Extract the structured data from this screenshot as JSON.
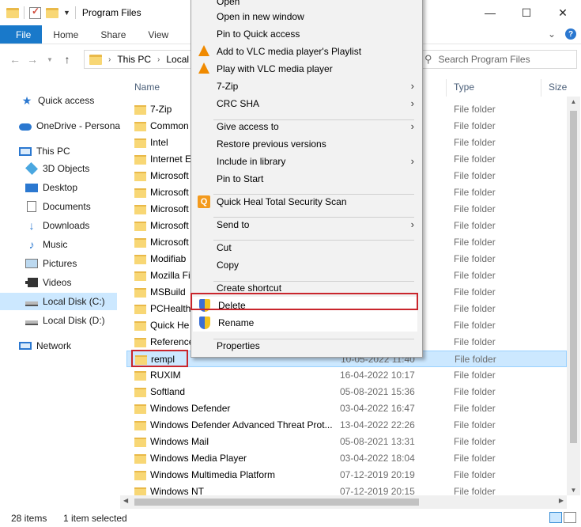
{
  "window": {
    "title": "Program Files",
    "minimize": "—",
    "maximize": "☐",
    "close": "✕"
  },
  "ribbon": {
    "tabs": [
      "File",
      "Home",
      "Share",
      "View"
    ],
    "expand": "⌄",
    "help": "?"
  },
  "address": {
    "path_parts": [
      "This PC",
      "Local"
    ],
    "search_placeholder": "Search Program Files"
  },
  "nav_pane": [
    {
      "label": "Quick access",
      "icon": "star-icon"
    },
    {
      "label": "OneDrive - Persona",
      "icon": "cloud-icon"
    },
    {
      "label": "This PC",
      "icon": "computer-icon"
    },
    {
      "label": "3D Objects",
      "icon": "cube-icon"
    },
    {
      "label": "Desktop",
      "icon": "desktop-icon"
    },
    {
      "label": "Documents",
      "icon": "document-icon"
    },
    {
      "label": "Downloads",
      "icon": "download-icon"
    },
    {
      "label": "Music",
      "icon": "music-icon"
    },
    {
      "label": "Pictures",
      "icon": "picture-icon"
    },
    {
      "label": "Videos",
      "icon": "video-icon"
    },
    {
      "label": "Local Disk (C:)",
      "icon": "disk-icon"
    },
    {
      "label": "Local Disk (D:)",
      "icon": "disk-icon"
    },
    {
      "label": "Network",
      "icon": "network-icon"
    }
  ],
  "columns": {
    "name": "Name",
    "type": "Type",
    "size": "Size"
  },
  "files": [
    {
      "name": "7-Zip",
      "date": "",
      "type": "File folder"
    },
    {
      "name": "Common",
      "date": "",
      "type": "File folder"
    },
    {
      "name": "Intel",
      "date": "",
      "type": "File folder"
    },
    {
      "name": "Internet E",
      "date": "",
      "type": "File folder"
    },
    {
      "name": "Microsoft",
      "date": "",
      "type": "File folder"
    },
    {
      "name": "Microsoft",
      "date": "",
      "type": "File folder"
    },
    {
      "name": "Microsoft",
      "date": "",
      "type": "File folder"
    },
    {
      "name": "Microsoft",
      "date": "",
      "type": "File folder"
    },
    {
      "name": "Microsoft",
      "date": "",
      "type": "File folder"
    },
    {
      "name": "Modifiab",
      "date": "",
      "type": "File folder"
    },
    {
      "name": "Mozilla Fi",
      "date": "",
      "type": "File folder"
    },
    {
      "name": "MSBuild",
      "date": "",
      "type": "File folder"
    },
    {
      "name": "PCHealth",
      "date": "",
      "type": "File folder"
    },
    {
      "name": "Quick He",
      "date": "",
      "type": "File folder"
    },
    {
      "name": "Reference",
      "date": "",
      "type": "File folder"
    },
    {
      "name": "rempl",
      "date": "10-05-2022 11:40",
      "type": "File folder"
    },
    {
      "name": "RUXIM",
      "date": "16-04-2022 10:17",
      "type": "File folder"
    },
    {
      "name": "Softland",
      "date": "05-08-2021 15:36",
      "type": "File folder"
    },
    {
      "name": "Windows Defender",
      "date": "03-04-2022 16:47",
      "type": "File folder"
    },
    {
      "name": "Windows Defender Advanced Threat Prot...",
      "date": "13-04-2022 22:26",
      "type": "File folder"
    },
    {
      "name": "Windows Mail",
      "date": "05-08-2021 13:31",
      "type": "File folder"
    },
    {
      "name": "Windows Media Player",
      "date": "03-04-2022 18:04",
      "type": "File folder"
    },
    {
      "name": "Windows Multimedia Platform",
      "date": "07-12-2019 20:19",
      "type": "File folder"
    },
    {
      "name": "Windows NT",
      "date": "07-12-2019 20:15",
      "type": "File folder"
    }
  ],
  "status": {
    "items": "28 items",
    "selected": "1 item selected"
  },
  "context_menu": [
    {
      "label": "Open",
      "icon": ""
    },
    {
      "label": "Open in new window",
      "icon": ""
    },
    {
      "label": "Pin to Quick access",
      "icon": ""
    },
    {
      "label": "Add to VLC media player's Playlist",
      "icon": "vlc-icon"
    },
    {
      "label": "Play with VLC media player",
      "icon": "vlc-icon"
    },
    {
      "label": "7-Zip",
      "icon": "",
      "submenu": true
    },
    {
      "label": "CRC SHA",
      "icon": "",
      "submenu": true
    },
    {
      "label": "Give access to",
      "icon": "",
      "submenu": true
    },
    {
      "label": "Restore previous versions",
      "icon": ""
    },
    {
      "label": "Include in library",
      "icon": "",
      "submenu": true
    },
    {
      "label": "Pin to Start",
      "icon": ""
    },
    {
      "label": "Quick Heal Total Security Scan",
      "icon": "quickheal-icon"
    },
    {
      "label": "Send to",
      "icon": "",
      "submenu": true
    },
    {
      "label": "Cut",
      "icon": ""
    },
    {
      "label": "Copy",
      "icon": ""
    },
    {
      "label": "Create shortcut",
      "icon": ""
    },
    {
      "label": "Delete",
      "icon": "shield-icon"
    },
    {
      "label": "Rename",
      "icon": "shield-icon"
    },
    {
      "label": "Properties",
      "icon": ""
    }
  ],
  "colors": {
    "accent": "#1979ca",
    "selection": "#cce8ff",
    "highlight_box": "#c9252c"
  }
}
